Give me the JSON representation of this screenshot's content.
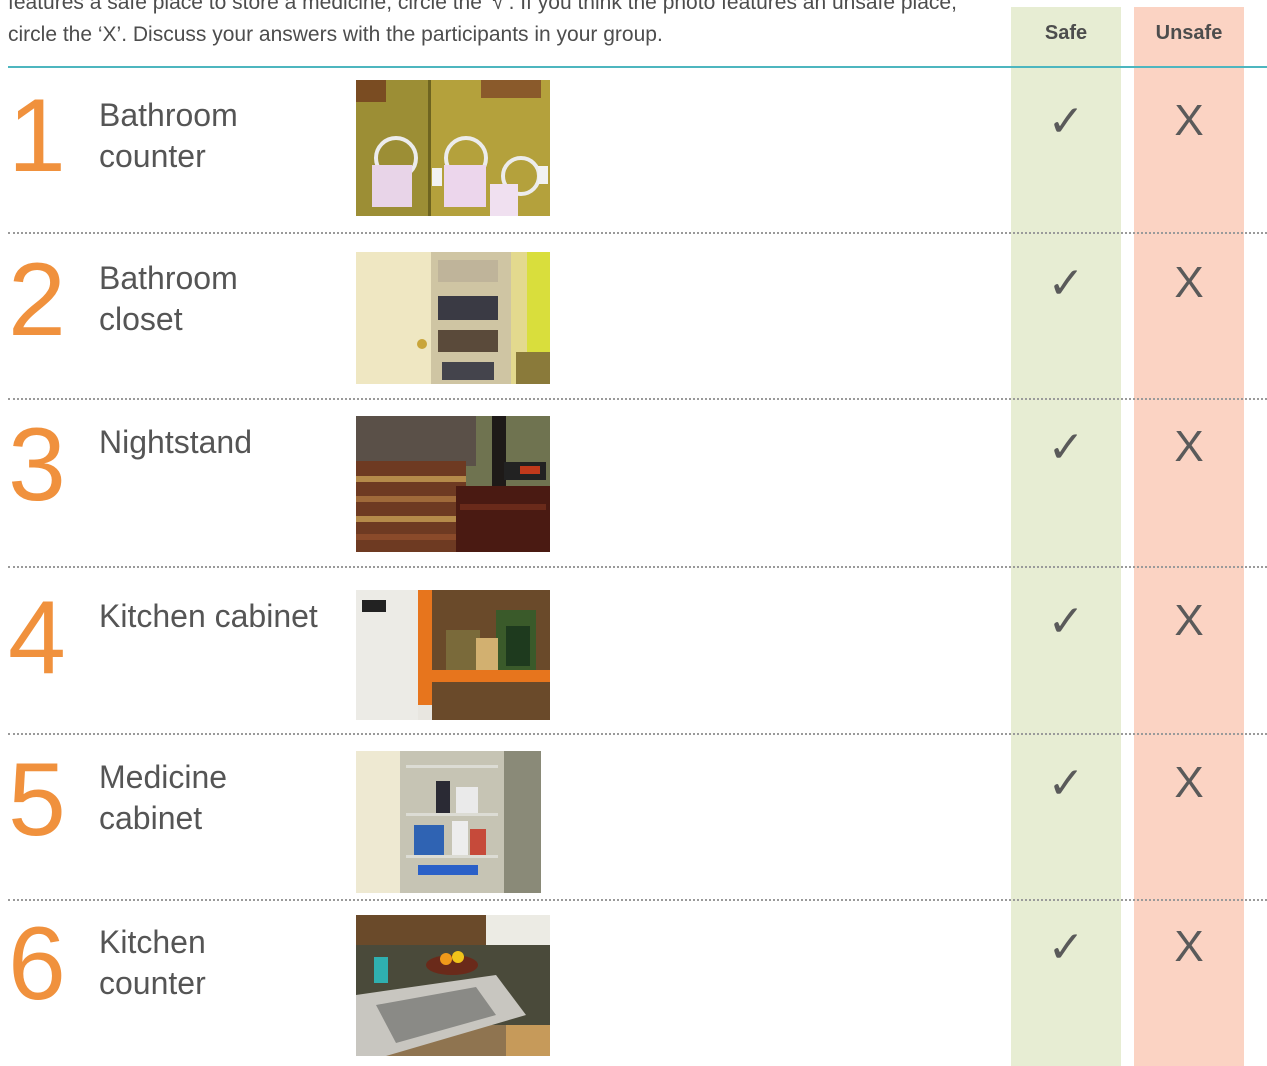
{
  "instructions": "features a safe place to store a medicine, circle the ‘√’. If you think the photo features an unsafe place, circle the ‘X’. Discuss your answers with the participants in your group.",
  "columns": {
    "safe": "Safe",
    "unsafe": "Unsafe"
  },
  "marks": {
    "check": "✓",
    "x": "X"
  },
  "colors": {
    "accent_number": "#f0913d",
    "safe_bg": "#e7edd3",
    "unsafe_bg": "#fbd3c3",
    "rule": "#4db6bf"
  },
  "items": [
    {
      "number": "1",
      "label": "Bathroom counter",
      "photo": "bathroom-counter-photo"
    },
    {
      "number": "2",
      "label": "Bathroom closet",
      "photo": "bathroom-closet-photo"
    },
    {
      "number": "3",
      "label": "Nightstand",
      "photo": "nightstand-photo"
    },
    {
      "number": "4",
      "label": "Kitchen cabinet",
      "photo": "kitchen-cabinet-photo"
    },
    {
      "number": "5",
      "label": "Medicine cabinet",
      "photo": "medicine-cabinet-photo"
    },
    {
      "number": "6",
      "label": "Kitchen counter",
      "photo": "kitchen-counter-photo"
    }
  ]
}
